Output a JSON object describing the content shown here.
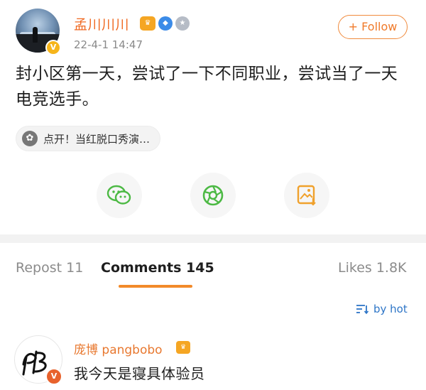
{
  "post": {
    "username": "孟川川川",
    "timestamp": "22-4-1 14:47",
    "follow_label": "+ Follow",
    "text": "封小区第一天，尝试了一下不同职业，尝试当了一天电竞选手。",
    "link_chip": "点开！当红脱口秀演…",
    "icons": {
      "verified": "verified-v-icon",
      "crown": "crown-badge-icon",
      "blue": "blue-badge-icon",
      "medal": "medal-badge-icon"
    }
  },
  "share": {
    "buttons": [
      "wechat-icon",
      "moments-icon",
      "save-image-icon"
    ]
  },
  "tabs": {
    "repost": "Repost 11",
    "comments": "Comments 145",
    "likes": "Likes 1.8K"
  },
  "sort": {
    "label": "by hot"
  },
  "comment": {
    "username": "庞博 pangbobo",
    "text": "我今天是寝具体验员"
  },
  "colors": {
    "accent": "#f28a2a",
    "username": "#f06b24",
    "link": "#2d75c7",
    "wechat_green": "#4cb944"
  }
}
